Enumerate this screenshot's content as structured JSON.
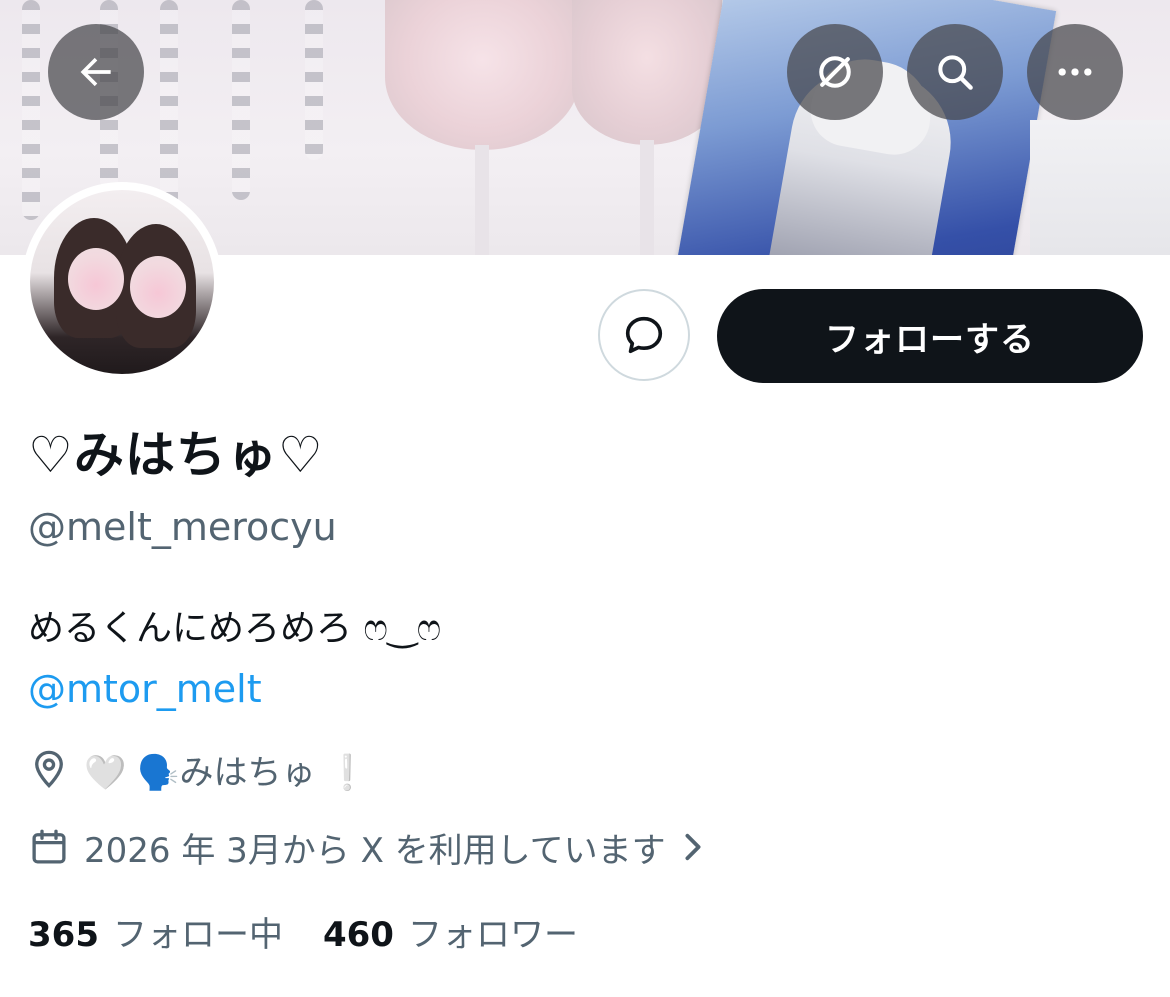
{
  "profile": {
    "display_name": "♡みはちゅ♡",
    "handle": "@melt_merocyu",
    "bio": "めるくんにめろめろ ෆ‿ෆ",
    "bio_link": "@mtor_melt",
    "location": "🤍 🗣️みはちゅ ❕",
    "joined": "2026 年 3月から X を利用しています"
  },
  "actions": {
    "follow_label": "フォローする"
  },
  "stats": {
    "following_count": "365",
    "following_label": "フォロー中",
    "followers_count": "460",
    "followers_label": "フォロワー"
  },
  "icons": {
    "back": "arrow-left-icon",
    "grok": "grok-icon",
    "search": "search-icon",
    "more": "more-horizontal-icon",
    "message": "message-bubble-icon",
    "location": "location-pin-icon",
    "calendar": "calendar-icon",
    "chevron": "chevron-right-icon"
  },
  "colors": {
    "primary_text": "#0f1419",
    "secondary_text": "#536471",
    "link": "#1d9bf0",
    "follow_button_bg": "#0f1419",
    "border": "#cfd9de"
  }
}
